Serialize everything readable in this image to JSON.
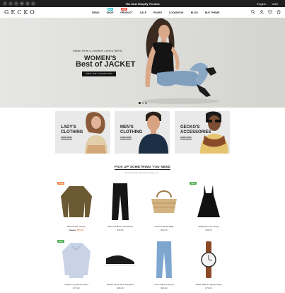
{
  "topbar": {
    "announcement": "The best Shopify Themes",
    "social_icons": [
      "facebook-icon",
      "twitter-icon",
      "instagram-icon",
      "linkedin-icon",
      "pinterest-icon",
      "youtube-icon"
    ],
    "language": "English",
    "currency": "USD"
  },
  "header": {
    "logo": "GECKO",
    "nav": [
      {
        "label": "DEMO",
        "badge": ""
      },
      {
        "label": "SHOP",
        "badge": "NEW",
        "badge_color": "#2ec4d6"
      },
      {
        "label": "PRODUCT",
        "badge": "HOT",
        "badge_color": "#e95144"
      },
      {
        "label": "SALE",
        "badge": ""
      },
      {
        "label": "PAGES",
        "badge": ""
      },
      {
        "label": "LOOKBOOK",
        "badge": ""
      },
      {
        "label": "BLOG",
        "badge": ""
      },
      {
        "label": "BUY THEME",
        "badge": ""
      }
    ],
    "wishlist_count": "0",
    "cart_count": "0"
  },
  "hero": {
    "tagline": "Made from a comfort cotton fabric",
    "title_line1": "WOMEN'S",
    "title_line2": "Best of JACKET",
    "cta": "VIEW THE COLLECTION",
    "slides": 3,
    "active_slide": 1
  },
  "categories": [
    {
      "line1": "LADY'S",
      "line2": "CLOTHING",
      "cta": "SHOP NOW"
    },
    {
      "line1": "MEN'S",
      "line2": "CLOTHING",
      "cta": "SHOP NOW"
    },
    {
      "line1": "GECKO'S",
      "line2": "ACCESSORIES",
      "cta": "SHOP NOW"
    }
  ],
  "featured": {
    "title": "PICK UP SOMETHING YOU NEED",
    "subtitle": "All round high and top to things you..."
  },
  "products": [
    {
      "name": "Boat Cotton Jersey",
      "old_price": "$99.00",
      "price": "$59.00",
      "badge": "SALE",
      "badge_color": "#f08a4b",
      "icon": "sweater"
    },
    {
      "name": "Sevens Fabric Track Pants",
      "old_price": "",
      "price": "$39.00",
      "badge": "",
      "icon": "pants"
    },
    {
      "name": "Coconut Straw Bags",
      "old_price": "",
      "price": "$29.00",
      "badge": "",
      "icon": "bag"
    },
    {
      "name": "Strapless Lane Jersey",
      "old_price": "",
      "price": "$49.00",
      "badge": "NEW",
      "badge_color": "#4caf50",
      "icon": "dress"
    },
    {
      "name": "Ladies Long Sleeve Shirt",
      "old_price": "",
      "price": "$75.00",
      "badge": "NEW",
      "badge_color": "#4caf50",
      "icon": "shirt"
    },
    {
      "name": "Classic Street New Sneakers",
      "old_price": "",
      "price": "$89.00",
      "badge": "",
      "icon": "shoe"
    },
    {
      "name": "Low Ladies Trousers",
      "old_price": "",
      "price": "$69.00",
      "badge": "",
      "icon": "jeans"
    },
    {
      "name": "Watch With A Leather Strap",
      "old_price": "",
      "price": "$79.00",
      "badge": "",
      "icon": "watch"
    }
  ]
}
